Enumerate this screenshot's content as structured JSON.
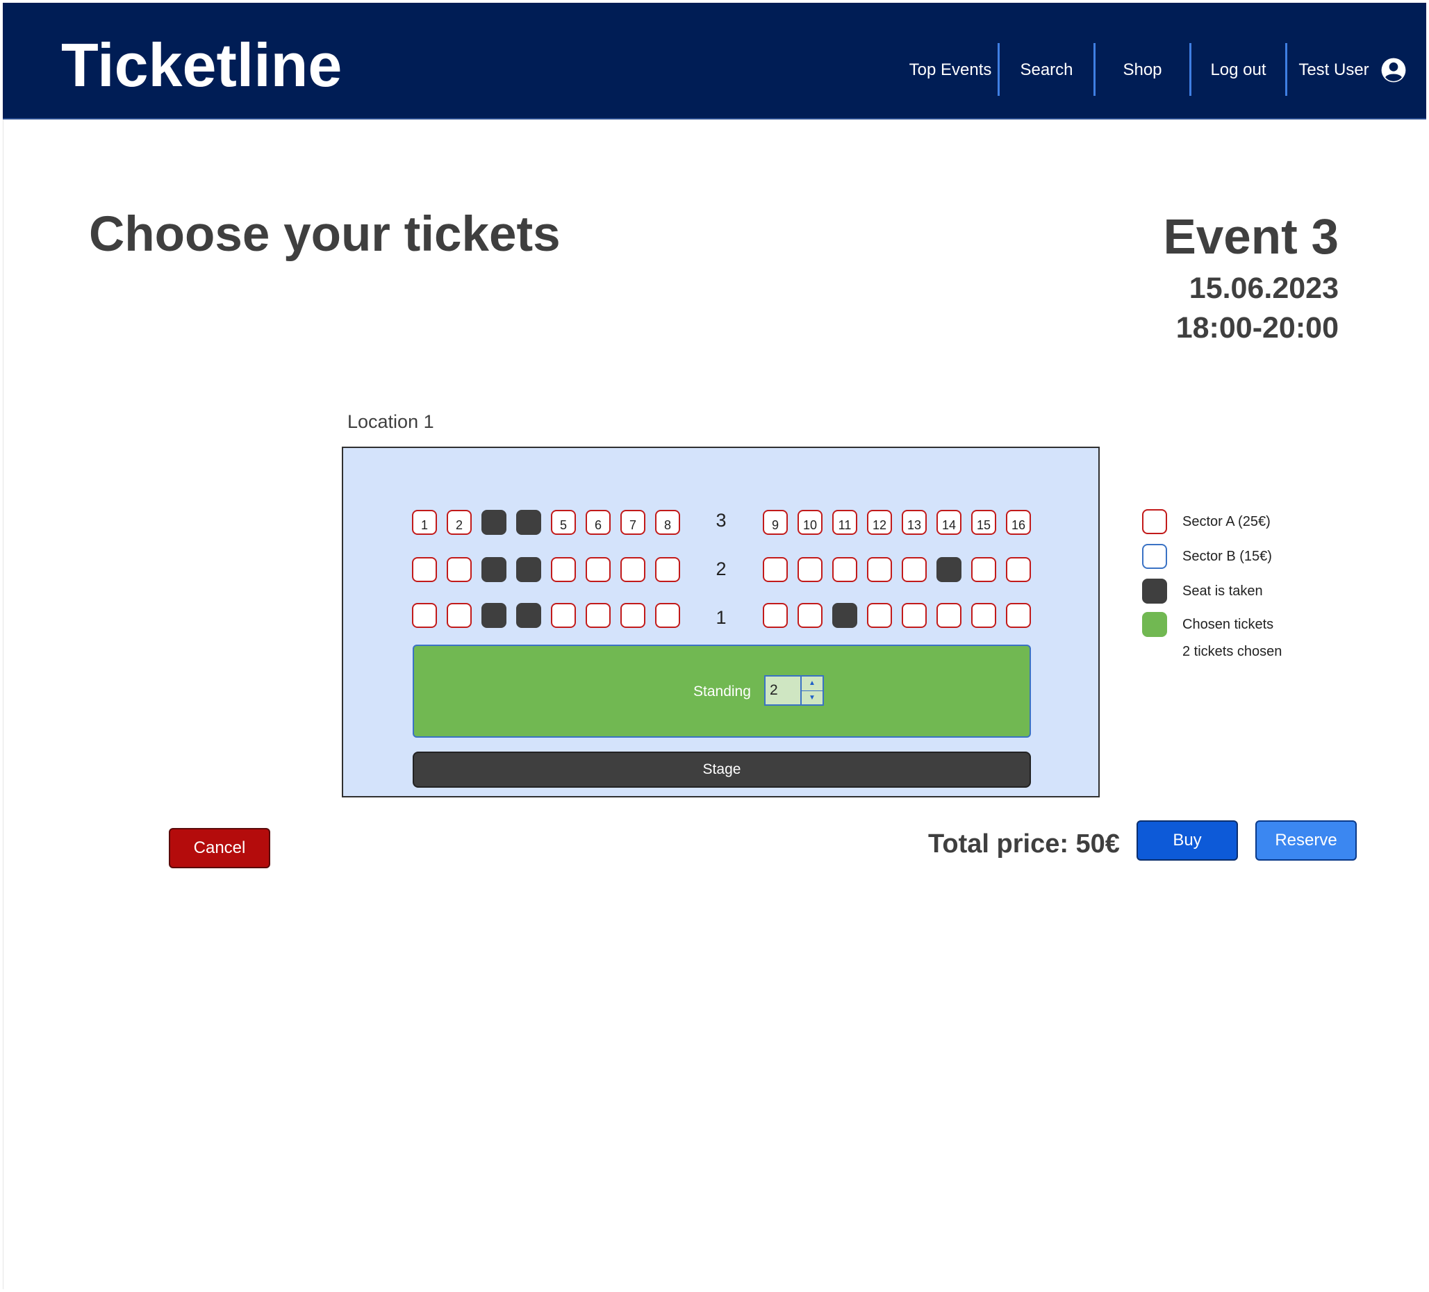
{
  "header": {
    "brand": "Ticketline",
    "nav": [
      "Top Events",
      "Search",
      "Shop",
      "Log out"
    ],
    "user_name": "Test User"
  },
  "page": {
    "title": "Choose your tickets"
  },
  "event": {
    "title": "Event 3",
    "date": "15.06.2023",
    "time": "18:00-20:00"
  },
  "location": {
    "name": "Location 1"
  },
  "seating": {
    "row_labels": [
      "3",
      "2",
      "1"
    ],
    "seat_numbers_row3": [
      "1",
      "2",
      "",
      "",
      "5",
      "6",
      "7",
      "8",
      "9",
      "10",
      "11",
      "12",
      "13",
      "14",
      "15",
      "16"
    ],
    "taken": {
      "3": [
        3,
        4
      ],
      "2": [
        3,
        4,
        14
      ],
      "1": [
        3,
        4,
        11
      ]
    }
  },
  "standing": {
    "label": "Standing",
    "value": "2",
    "stepper_up_icon": "▲",
    "stepper_down_icon": "▼"
  },
  "stage": {
    "label": "Stage"
  },
  "legend": {
    "sector_a": "Sector A (25€)",
    "sector_b": "Sector B (15€)",
    "taken": "Seat is taken",
    "chosen": "Chosen tickets",
    "count": "2 tickets chosen"
  },
  "actions": {
    "cancel": "Cancel",
    "total": "Total price: 50€",
    "buy": "Buy",
    "reserve": "Reserve"
  },
  "colors": {
    "header_bg": "#001d55",
    "venue_bg": "#d4e3fb",
    "sector_a_border": "#c21a1a",
    "sector_b_border": "#3a72c4",
    "seat_taken": "#3f3f3f",
    "chosen_green": "#71b852",
    "cancel_red": "#b40c0c",
    "buy_blue": "#0d5ad8",
    "reserve_blue": "#3b87f1"
  },
  "icons": {
    "user": "account-circle-icon"
  }
}
